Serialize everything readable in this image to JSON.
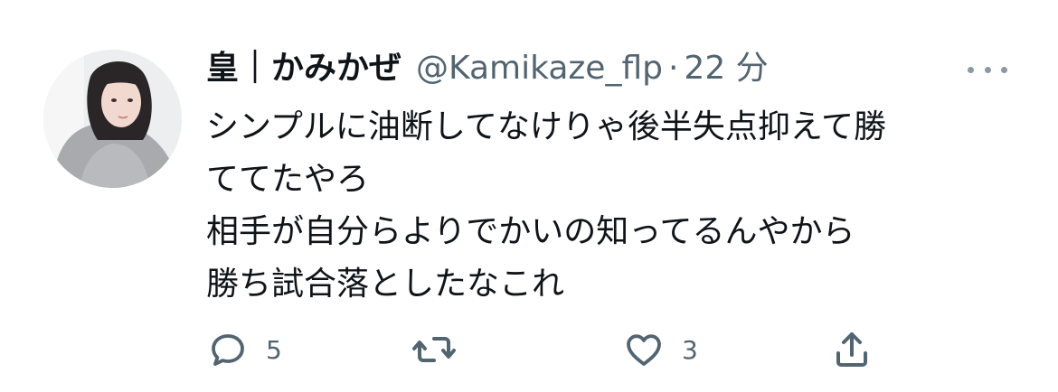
{
  "tweet": {
    "display_name": "皇｜かみかぜ",
    "handle": "@Kamikaze_flp",
    "separator": "·",
    "time": "22 分",
    "lines": [
      "シンプルに油断してなけりゃ後半失点抑えて勝",
      "ててたやろ",
      "相手が自分らよりでかいの知ってるんやから",
      "勝ち試合落としたなこれ"
    ],
    "reply_count": "5",
    "retweet_count": "",
    "like_count": "3",
    "icons": {
      "reply": "reply-icon",
      "retweet": "retweet-icon",
      "like": "heart-icon",
      "share": "share-icon",
      "more": "more-icon"
    },
    "colors": {
      "text": "#0f1419",
      "secondary": "#536471",
      "icon": "#536471"
    }
  }
}
